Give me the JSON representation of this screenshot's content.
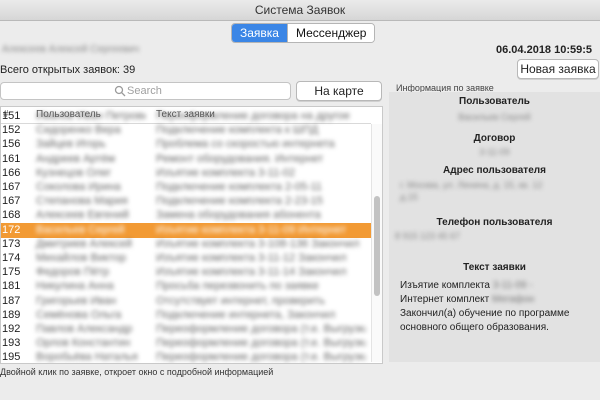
{
  "window": {
    "title": "Система Заявок"
  },
  "tabs": [
    {
      "label": "Заявка",
      "active": true
    },
    {
      "label": "Мессенджер",
      "active": false
    }
  ],
  "header": {
    "user_name": "Алексеев Алексей Сергеевич",
    "datetime": "06.04.2018 10:59:5",
    "open_requests": "Всего открытых заявок:  39",
    "new_request_button": "Новая заявка"
  },
  "search": {
    "placeholder": "Search"
  },
  "map_button": "На карте",
  "table": {
    "columns": [
      "#",
      "Пользователь",
      "Текст заявки"
    ],
    "rows": [
      {
        "num": "151",
        "user": "Иванов Иван Петрович",
        "text": "Переоформление договора на другое"
      },
      {
        "num": "152",
        "user": "Сидоренко Вера",
        "text": "Подключение комплекта к ШПД"
      },
      {
        "num": "156",
        "user": "Зайцев Игорь",
        "text": "Проблема со скоростью интернета"
      },
      {
        "num": "161",
        "user": "Андреев Артём",
        "text": "Ремонт оборудования. Интернет"
      },
      {
        "num": "166",
        "user": "Кузнецов Олег",
        "text": "Изъятие комплекта 3-11-02"
      },
      {
        "num": "167",
        "user": "Соколова Ирина",
        "text": "Подключение комплекта 2-05-11"
      },
      {
        "num": "167",
        "user": "Степанова Мария",
        "text": "Подключение комплекта 2-23-15"
      },
      {
        "num": "168",
        "user": "Алексеев Евгений",
        "text": "Замена оборудования абонента"
      },
      {
        "num": "172",
        "user": "Васильев Сергей",
        "text": "Изъятие комплекта 3-11-09 Интернет",
        "selected": true
      },
      {
        "num": "173",
        "user": "Дмитриев Алексей",
        "text": "Изъятие комплекта 3-108-136 Закончил"
      },
      {
        "num": "174",
        "user": "Михайлов Виктор",
        "text": "Изъятие комплекта 3-11-12 Закончил"
      },
      {
        "num": "175",
        "user": "Федоров Пётр",
        "text": "Изъятие комплекта 3-11-14 Закончил"
      },
      {
        "num": "181",
        "user": "Никулина Анна",
        "text": "Просьба перезвонить по заявке"
      },
      {
        "num": "187",
        "user": "Григорьев Иван",
        "text": "Отсутствует интернет, проверить"
      },
      {
        "num": "189",
        "user": "Семёнова Ольга",
        "text": "Подключение интернета, Закончил"
      },
      {
        "num": "192",
        "user": "Павлов Александр",
        "text": "Переоформление договора (т.е. Выгрузка"
      },
      {
        "num": "193",
        "user": "Орлов Константин",
        "text": "Переоформление договора (т.е. Выгрузка"
      },
      {
        "num": "195",
        "user": "Воробьёва Наталья",
        "text": "Переоформление договора (т.е. Выгрузка"
      }
    ]
  },
  "info": {
    "panel_title": "Информация по заявке",
    "user_label": "Пользователь",
    "user_value": "Васильев Сергей",
    "contract_label": "Договор",
    "contract_value": "3-11-09",
    "address_label": "Адрес пользователя",
    "address_line1": "г. Москва, ул. Ленина, д. 15, кв. 12",
    "address_line2": "д.15",
    "phone_label": "Телефон пользователя",
    "phone_value": "8 915 123 45 67",
    "request_label": "Текст заявки",
    "request_line1": "Изъятие комплекта",
    "request_line1_blur": "3-11-09 -",
    "request_line2": "Интернет комплект",
    "request_line2_blur": "Мегафон",
    "request_line3": "Закончил(а) обучение по программе",
    "request_line4": "основного общего образования."
  },
  "status_bar": {
    "text": "Двойной клик по заявке, откроет окно с подробной информацией"
  }
}
